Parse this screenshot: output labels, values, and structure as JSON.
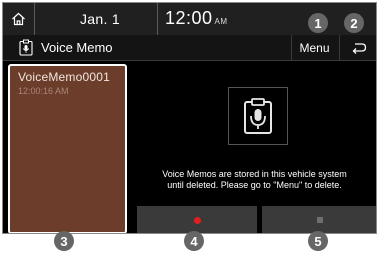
{
  "status_bar": {
    "home_icon": "home-icon",
    "date": "Jan. 1",
    "time": "12:00",
    "ampm": "AM"
  },
  "title_bar": {
    "icon": "voice-memo-icon",
    "title": "Voice Memo",
    "menu_label": "Menu",
    "back_icon": "back-arrow-icon"
  },
  "memo_list": {
    "items": [
      {
        "name": "VoiceMemo0001",
        "time": "12:00:16 AM"
      }
    ]
  },
  "main": {
    "icon": "microphone-clipboard-icon",
    "notice_lines": [
      "Voice Memos are stored in this vehicle system",
      "until deleted. Please go to \"Menu\" to delete."
    ],
    "record_icon": "record-icon",
    "stop_icon": "stop-icon"
  },
  "callouts": [
    "1",
    "2",
    "3",
    "4",
    "5"
  ],
  "colors": {
    "list_background": "#6b3d2a",
    "record_dot": "#e21e1e",
    "badge": "#666666"
  }
}
